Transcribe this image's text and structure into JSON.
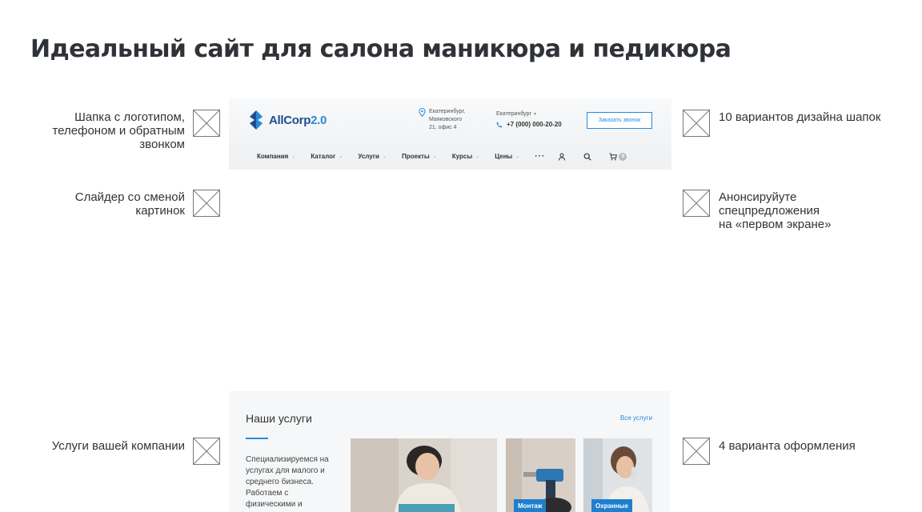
{
  "page": {
    "title": "Идеальный сайт для салона маникюра и педикюра"
  },
  "annotations": {
    "header_left": "Шапка с логотипом,\nтелефоном и обратным\nзвонком",
    "header_right": "10 вариантов дизайна шапок",
    "slider_left": "Слайдер со сменой\nкартинок",
    "slider_right": "Анонсируйуте\nспецпредложения\nна «первом экране»",
    "services_left": "Услуги вашей компании",
    "services_right": "4 варианта оформления"
  },
  "site": {
    "logo": {
      "name": "AllCorp",
      "version": "2.0"
    },
    "address": "Екатеринбург,\nМаяковского\n21, офис 4",
    "city": "Екатеринбург",
    "phone": "+7 (000) 000-20-20",
    "callback_button": "Заказать звонок",
    "nav": [
      "Компания",
      "Каталог",
      "Услуги",
      "Проекты",
      "Курсы",
      "Цены"
    ],
    "nav_more": "···",
    "cart_count": "0",
    "icons": [
      "location-pin-icon",
      "phone-icon",
      "user-icon",
      "search-icon",
      "cart-icon"
    ]
  },
  "services": {
    "title": "Наши услуги",
    "all_link": "Все услуги",
    "description": "Специализируемся на услугах для малого и среднего бизнеса. Работаем с физическими и",
    "tags": [
      "Монтаж",
      "Охранные"
    ]
  },
  "colors": {
    "accent": "#2a8bd8",
    "logo_dark": "#1a4f8f",
    "tag_bg": "#1f7fcf",
    "title": "#2f3237"
  }
}
